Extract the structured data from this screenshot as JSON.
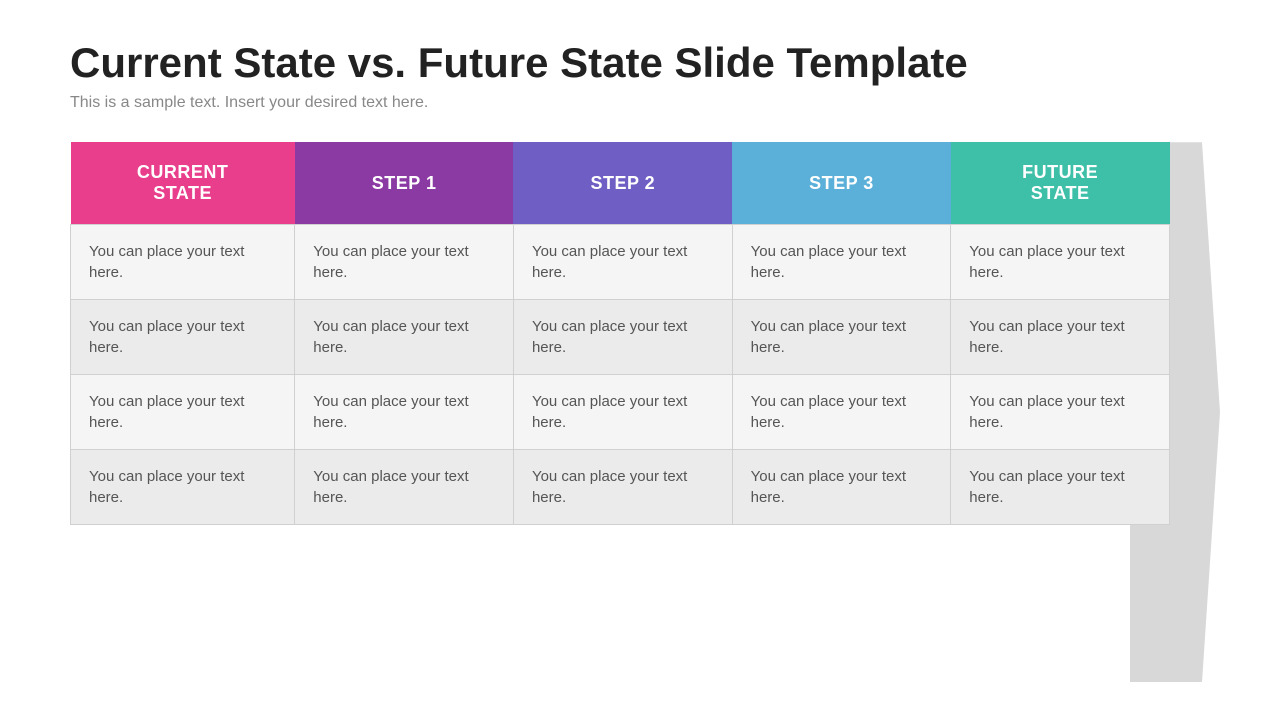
{
  "title": "Current State vs. Future State Slide Template",
  "subtitle": "This is a sample text. Insert your desired text here.",
  "table": {
    "headers": [
      {
        "id": "current",
        "label": "CURRENT\nSTATE",
        "class": "col-current"
      },
      {
        "id": "step1",
        "label": "STEP 1",
        "class": "col-step1"
      },
      {
        "id": "step2",
        "label": "STEP 2",
        "class": "col-step2"
      },
      {
        "id": "step3",
        "label": "STEP 3",
        "class": "col-step3"
      },
      {
        "id": "future",
        "label": "FUTURE\nSTATE",
        "class": "col-future"
      }
    ],
    "cell_text": "You can place your text here.",
    "rows": 4
  }
}
